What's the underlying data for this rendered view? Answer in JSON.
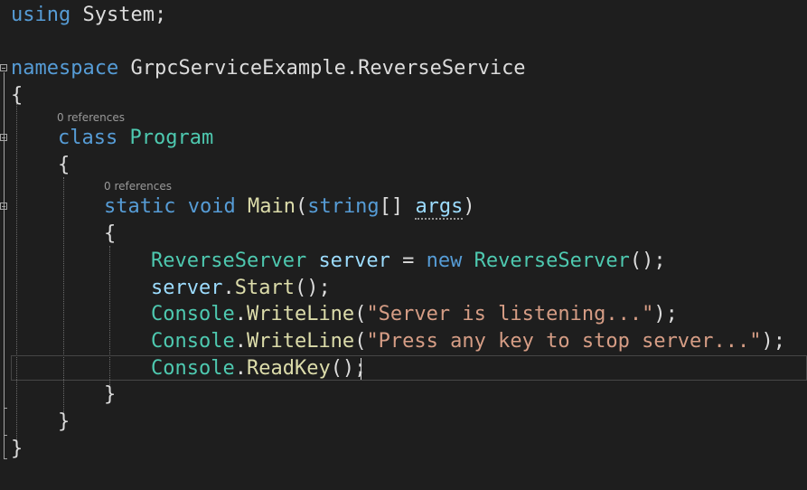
{
  "code": {
    "lines": [
      {
        "tokens": [
          {
            "t": "using",
            "c": "kw"
          },
          {
            "t": " System;",
            "c": "plain"
          }
        ]
      },
      {
        "tokens": []
      },
      {
        "tokens": [
          {
            "t": "namespace",
            "c": "kw"
          },
          {
            "t": " GrpcServiceExample.ReverseService",
            "c": "plain"
          }
        ]
      },
      {
        "tokens": [
          {
            "t": "{",
            "c": "punc"
          }
        ]
      },
      {
        "tokens": [
          {
            "t": "class",
            "c": "kw"
          },
          {
            "t": " ",
            "c": "plain"
          },
          {
            "t": "Program",
            "c": "type"
          }
        ]
      },
      {
        "tokens": [
          {
            "t": "{",
            "c": "punc"
          }
        ]
      },
      {
        "tokens": [
          {
            "t": "static",
            "c": "kw"
          },
          {
            "t": " ",
            "c": "plain"
          },
          {
            "t": "void",
            "c": "kw"
          },
          {
            "t": " ",
            "c": "plain"
          },
          {
            "t": "Main",
            "c": "method"
          },
          {
            "t": "(",
            "c": "punc"
          },
          {
            "t": "string",
            "c": "kw"
          },
          {
            "t": "[] ",
            "c": "punc"
          },
          {
            "t": "args",
            "c": "ident",
            "dotted": true
          },
          {
            "t": ")",
            "c": "punc"
          }
        ]
      },
      {
        "tokens": [
          {
            "t": "{",
            "c": "punc"
          }
        ]
      },
      {
        "tokens": [
          {
            "t": "ReverseServer",
            "c": "type"
          },
          {
            "t": " ",
            "c": "plain"
          },
          {
            "t": "server",
            "c": "ident"
          },
          {
            "t": " = ",
            "c": "punc"
          },
          {
            "t": "new",
            "c": "kw"
          },
          {
            "t": " ",
            "c": "plain"
          },
          {
            "t": "ReverseServer",
            "c": "type"
          },
          {
            "t": "();",
            "c": "punc"
          }
        ]
      },
      {
        "tokens": [
          {
            "t": "server",
            "c": "ident"
          },
          {
            "t": ".",
            "c": "punc"
          },
          {
            "t": "Start",
            "c": "method"
          },
          {
            "t": "();",
            "c": "punc"
          }
        ]
      },
      {
        "tokens": [
          {
            "t": "Console",
            "c": "type"
          },
          {
            "t": ".",
            "c": "punc"
          },
          {
            "t": "WriteLine",
            "c": "method"
          },
          {
            "t": "(",
            "c": "punc"
          },
          {
            "t": "\"Server is listening...\"",
            "c": "str"
          },
          {
            "t": ");",
            "c": "punc"
          }
        ]
      },
      {
        "tokens": [
          {
            "t": "Console",
            "c": "type"
          },
          {
            "t": ".",
            "c": "punc"
          },
          {
            "t": "WriteLine",
            "c": "method"
          },
          {
            "t": "(",
            "c": "punc"
          },
          {
            "t": "\"Press any key to stop server...\"",
            "c": "str"
          },
          {
            "t": ");",
            "c": "punc"
          }
        ]
      },
      {
        "tokens": [
          {
            "t": "Console",
            "c": "type"
          },
          {
            "t": ".",
            "c": "punc"
          },
          {
            "t": "ReadKey",
            "c": "method"
          },
          {
            "t": "();",
            "c": "punc"
          }
        ]
      },
      {
        "tokens": [
          {
            "t": "}",
            "c": "punc"
          }
        ]
      },
      {
        "tokens": [
          {
            "t": "}",
            "c": "punc"
          }
        ]
      },
      {
        "tokens": [
          {
            "t": "}",
            "c": "punc"
          }
        ]
      }
    ],
    "codelens": [
      {
        "text": "0 references"
      },
      {
        "text": "0 references"
      }
    ]
  },
  "colors": {
    "background": "#1e1e1e",
    "keyword": "#569cd6",
    "type": "#4ec9b0",
    "method": "#dcdcaa",
    "identifier": "#9cdcfe",
    "string": "#d69d85",
    "text": "#dcdcdc"
  },
  "icons": {
    "fold": "collapse-minus-icon"
  }
}
